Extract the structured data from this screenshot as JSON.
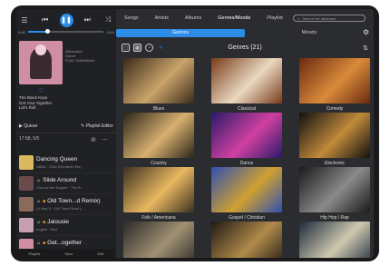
{
  "player": {
    "time_elapsed": "0:40",
    "time_total": "-3:14",
    "progress_fraction": 0.25,
    "meta_lines": [
      "Alternative",
      "Genre",
      "FLAC 16bit/44kHz"
    ],
    "track_lines": [
      "The Black Keys",
      "Got Your Together",
      "Let's Roll"
    ],
    "queue_label": "Queue",
    "playlist_editor_label": "Playlist Editor"
  },
  "queue": {
    "info": "17:58, 5/5",
    "info_sub": "",
    "items": [
      {
        "title": "Dancing Queen",
        "sub": "ABBA · Gold (Greatest Hits)",
        "badges": [],
        "color": "#d9b860"
      },
      {
        "title": "Slide Around",
        "sub": "Chance the Rapper · The B...",
        "badges": [
          "☺"
        ],
        "color": "#6a4a4a"
      },
      {
        "title": "Old Town...d Remix)",
        "sub": "Lil Nas X · Old Town Road (...",
        "badges": [
          "☺",
          "■"
        ],
        "color": "#8a6a5a"
      },
      {
        "title": "Jalousie",
        "sub": "Angèle · Brol",
        "badges": [
          "☺",
          "■"
        ],
        "color": "#c7a0b0"
      },
      {
        "title": "Get...ogether",
        "sub": "The Black Keys · \"Let's R...",
        "badges": [
          "☺",
          "■"
        ],
        "color": "#cf8ea3"
      }
    ],
    "bottom_buttons": [
      "Playlist",
      "Save",
      "Edit"
    ]
  },
  "nav": {
    "tabs": [
      "Songs",
      "Artists",
      "Albums",
      "Genres/Moods",
      "Playlist"
    ],
    "active_tab": 3,
    "search_placeholder": "Search the database"
  },
  "subtabs": {
    "items": [
      "Genres",
      "Moods"
    ],
    "active": 0
  },
  "toolbar": {
    "title": "Genres (21)"
  },
  "genres": [
    {
      "label": "Blues",
      "c1": "#3a2a1a",
      "c2": "#c9a46a"
    },
    {
      "label": "Classical",
      "c1": "#7a3a1a",
      "c2": "#e9d9c0"
    },
    {
      "label": "Comedy",
      "c1": "#6a2a10",
      "c2": "#d98a3a"
    },
    {
      "label": "Country",
      "c1": "#2a2418",
      "c2": "#d8b070"
    },
    {
      "label": "Dance",
      "c1": "#2a1a6a",
      "c2": "#d040a0"
    },
    {
      "label": "Electronic",
      "c1": "#101010",
      "c2": "#c08a3a"
    },
    {
      "label": "Folk / Americana",
      "c1": "#3a3020",
      "c2": "#e8b860"
    },
    {
      "label": "Gospel / Christian",
      "c1": "#3050b0",
      "c2": "#d0a030"
    },
    {
      "label": "Hip Hop / Rap",
      "c1": "#1a1a1a",
      "c2": "#8a8a8a"
    },
    {
      "label": "",
      "c1": "#2a2a2a",
      "c2": "#a09070"
    },
    {
      "label": "",
      "c1": "#201a14",
      "c2": "#b08a4a"
    },
    {
      "label": "",
      "c1": "#1a2a3a",
      "c2": "#d0c8b0"
    }
  ],
  "colors": {
    "accent": "#2d8ce8",
    "panel": "#2b2c2f"
  }
}
